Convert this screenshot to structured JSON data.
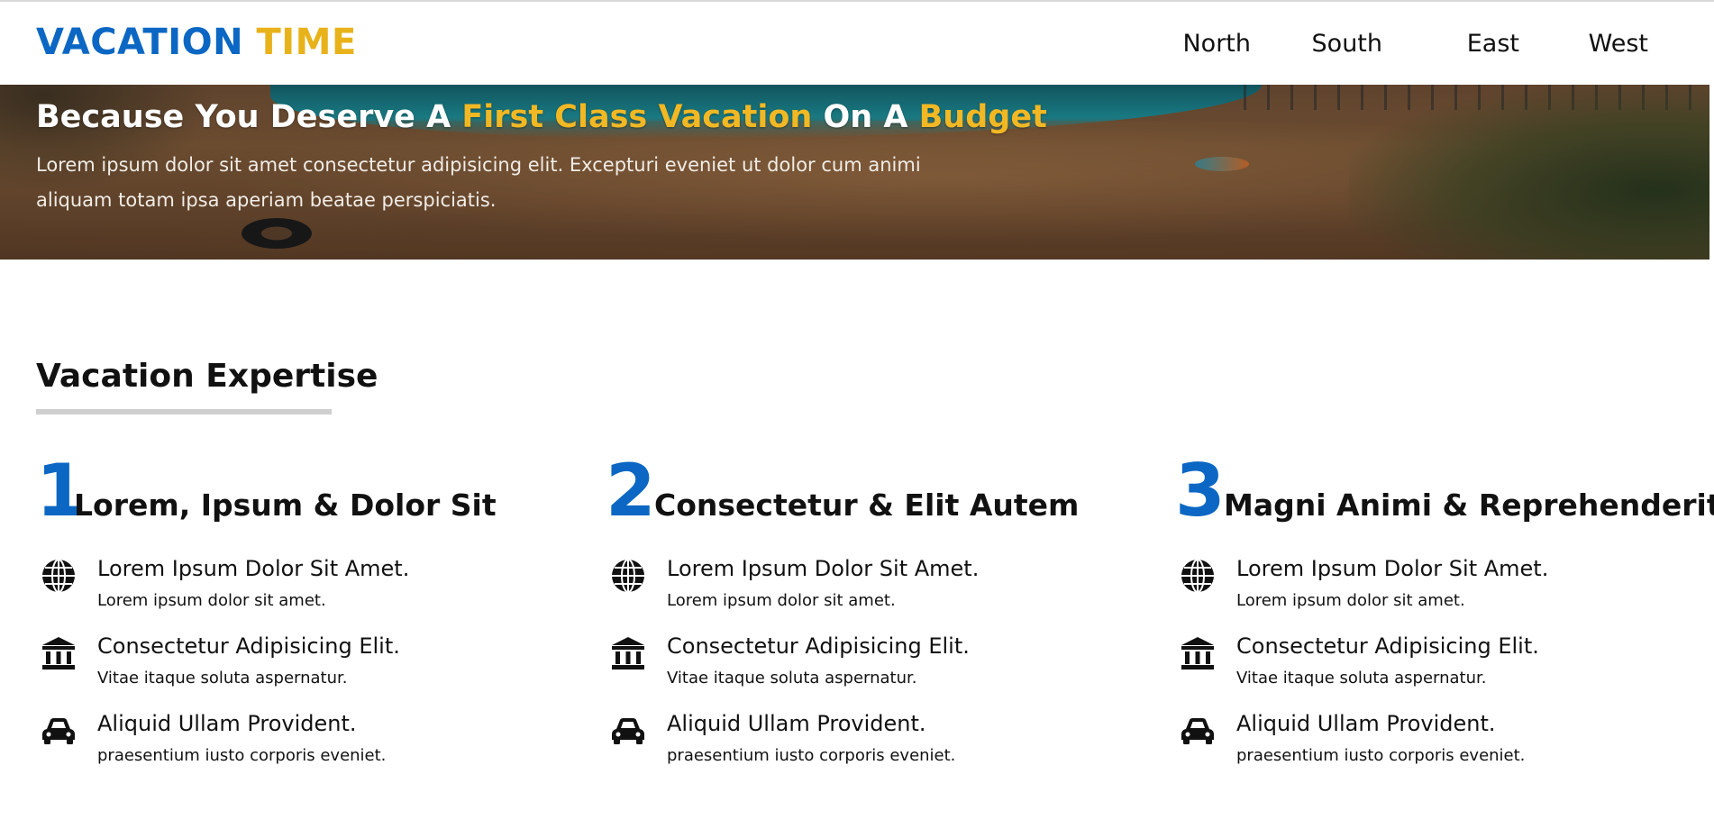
{
  "header": {
    "logo_part1": "VACATION",
    "logo_part2": "TIME",
    "nav": [
      "North",
      "South",
      "East",
      "West"
    ]
  },
  "hero": {
    "title_part1": "Because You Deserve A ",
    "title_highlight1": "First Class Vacation",
    "title_part2": " On A ",
    "title_highlight2": "Budget",
    "text": "Lorem ipsum dolor sit amet consectetur adipisicing elit. Excepturi eveniet ut dolor cum animi aliquam totam ipsa aperiam beatae perspiciatis."
  },
  "section": {
    "title": "Vacation Expertise"
  },
  "columns": [
    {
      "number": "1",
      "title": "Lorem, Ipsum & Dolor Sit",
      "items": [
        {
          "icon": "globe-icon",
          "title": "Lorem Ipsum Dolor Sit Amet.",
          "subtitle": "Lorem ipsum dolor sit amet."
        },
        {
          "icon": "university-icon",
          "title": "Consectetur Adipisicing Elit.",
          "subtitle": "Vitae itaque soluta aspernatur."
        },
        {
          "icon": "car-icon",
          "title": "Aliquid Ullam Provident.",
          "subtitle": "praesentium iusto corporis eveniet."
        }
      ]
    },
    {
      "number": "2",
      "title": "Consectetur & Elit Autem",
      "items": [
        {
          "icon": "globe-icon",
          "title": "Lorem Ipsum Dolor Sit Amet.",
          "subtitle": "Lorem ipsum dolor sit amet."
        },
        {
          "icon": "university-icon",
          "title": "Consectetur Adipisicing Elit.",
          "subtitle": "Vitae itaque soluta aspernatur."
        },
        {
          "icon": "car-icon",
          "title": "Aliquid Ullam Provident.",
          "subtitle": "praesentium iusto corporis eveniet."
        }
      ]
    },
    {
      "number": "3",
      "title": "Magni Animi & Reprehenderit",
      "items": [
        {
          "icon": "globe-icon",
          "title": "Lorem Ipsum Dolor Sit Amet.",
          "subtitle": "Lorem ipsum dolor sit amet."
        },
        {
          "icon": "university-icon",
          "title": "Consectetur Adipisicing Elit.",
          "subtitle": "Vitae itaque soluta aspernatur."
        },
        {
          "icon": "car-icon",
          "title": "Aliquid Ullam Provident.",
          "subtitle": "praesentium iusto corporis eveniet."
        }
      ]
    }
  ],
  "colors": {
    "brand_blue": "#0b67c3",
    "brand_gold": "#e8b21a",
    "text": "#111111"
  }
}
